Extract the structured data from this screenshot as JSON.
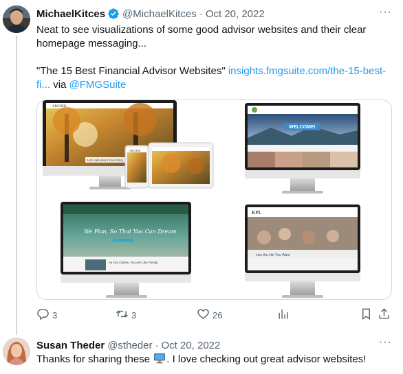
{
  "tweet1": {
    "author_name": "MichaelKitces",
    "handle": "@MichaelKitces",
    "separator": "·",
    "date": "Oct 20, 2022",
    "text_line": "Neat to see visualizations of some good advisor websites and their clear homepage messaging...",
    "quote_title": "\"The 15 Best Financial Advisor Websites\"",
    "link_text": "insights.fmgsuite.com/the-15-best-fi...",
    "via_text": "via",
    "mention": "@FMGSuite",
    "replies": "3",
    "retweets": "3",
    "likes": "26",
    "media_texts": {
      "mock1_logo": "ARCHER",
      "mock1_banner": "Let's talk about Your Story",
      "mock1_tablet_logo": "ARCHER",
      "mock2_logo": "",
      "mock2_banner": "WELCOME!",
      "mock3_banner": "We Plan, So That You Can Dream",
      "mock3_caption": "As Our Clients, You Are Like Family",
      "mock4_logo": "KPL",
      "mock4_banner": "Live the Life You Want"
    }
  },
  "tweet2": {
    "author_name": "Susan Theder",
    "handle": "@stheder",
    "separator": "·",
    "date": "Oct 20, 2022",
    "text_before": "Thanks for sharing these",
    "text_after": ". I love checking out great advisor websites!"
  },
  "icons": [
    "verified-badge-icon",
    "more-icon",
    "reply-icon",
    "retweet-icon",
    "like-icon",
    "views-icon",
    "bookmark-icon",
    "share-icon",
    "computer-emoji-icon"
  ],
  "colors": {
    "accent": "#1d9bf0",
    "secondary_text": "#536471",
    "border": "#cfd9de"
  }
}
